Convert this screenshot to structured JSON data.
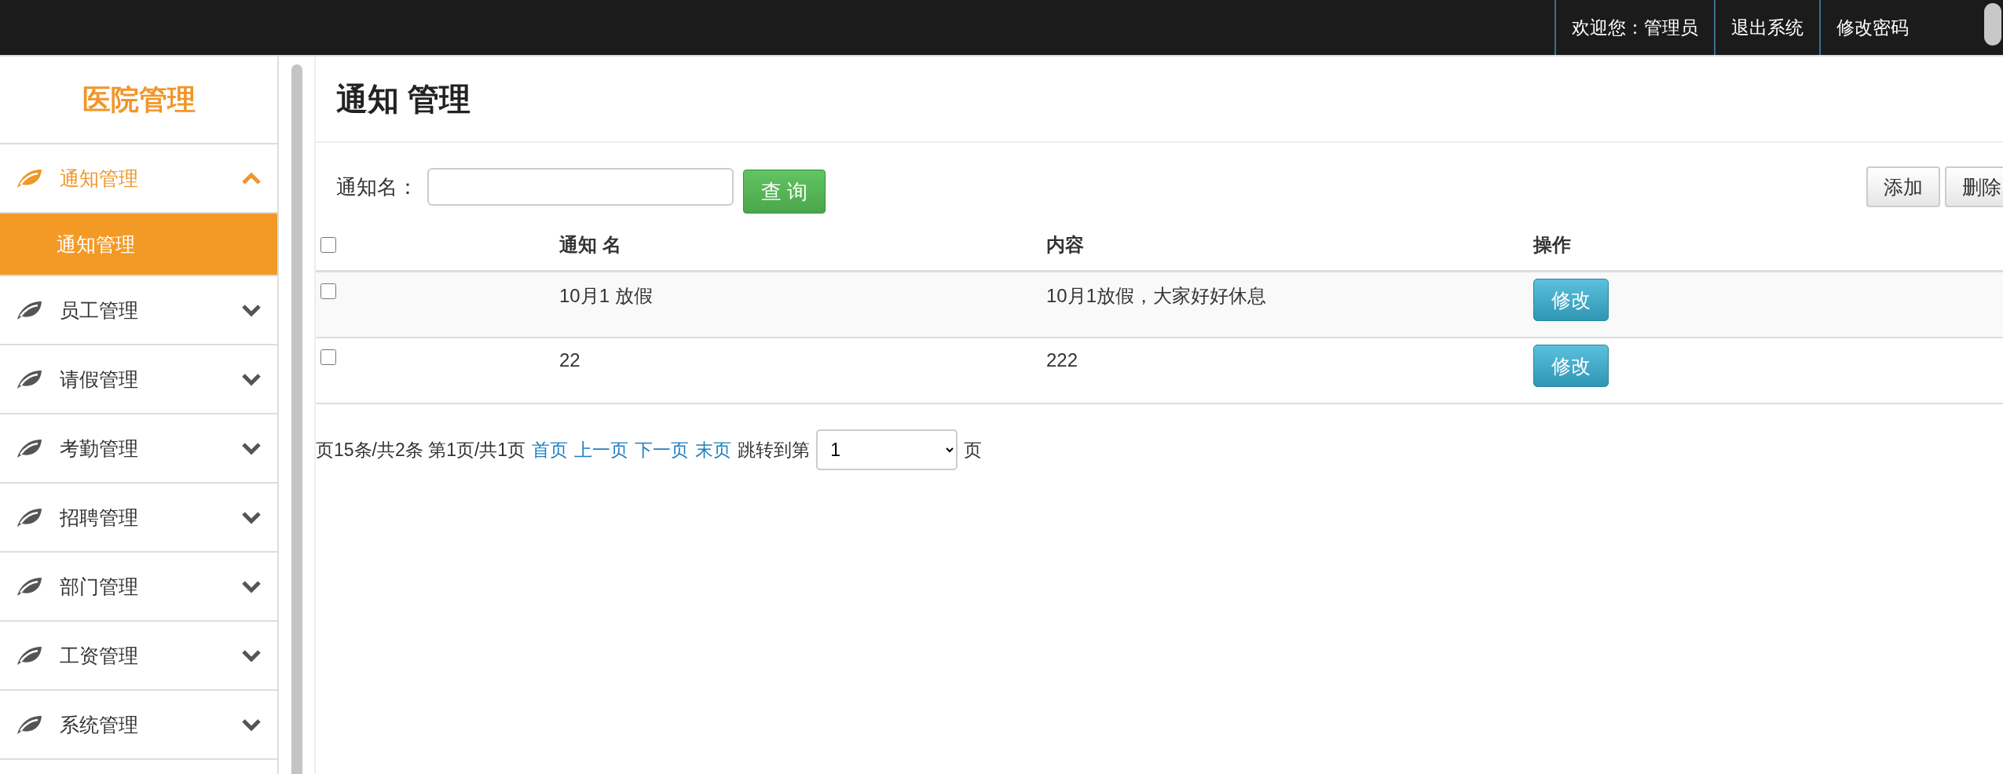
{
  "top_bar": {
    "welcome": "欢迎您：管理员",
    "links": [
      "退出系统",
      "修改密码"
    ]
  },
  "sidebar": {
    "title": "医院管理",
    "items": [
      {
        "label": "通知管理",
        "expanded": true,
        "children": [
          {
            "label": "通知管理",
            "selected": true
          }
        ]
      },
      {
        "label": "员工管理",
        "expanded": false
      },
      {
        "label": "请假管理",
        "expanded": false
      },
      {
        "label": "考勤管理",
        "expanded": false
      },
      {
        "label": "招聘管理",
        "expanded": false
      },
      {
        "label": "部门管理",
        "expanded": false
      },
      {
        "label": "工资管理",
        "expanded": false
      },
      {
        "label": "系统管理",
        "expanded": false
      }
    ]
  },
  "page_title": "通知 管理",
  "search": {
    "label": "通知名：",
    "button": "查 询"
  },
  "actions": [
    "添加",
    "删除"
  ],
  "table": {
    "header_checked": false,
    "columns": [
      "通知 名",
      "内容",
      "操作"
    ],
    "rows": [
      {
        "checked": false,
        "name": "10月1 放假",
        "content": "10月1放假，大家好好休息",
        "action": "修改"
      },
      {
        "checked": false,
        "name": "22",
        "content": "222",
        "action": "修改"
      }
    ]
  },
  "pagination": {
    "summary": "页15条/共2条 第1页/共1页",
    "links": [
      "首页",
      "上一页",
      "下一页",
      "末页"
    ],
    "jump_label": "跳转到第",
    "page_value": "1",
    "page_suffix": "页"
  }
}
